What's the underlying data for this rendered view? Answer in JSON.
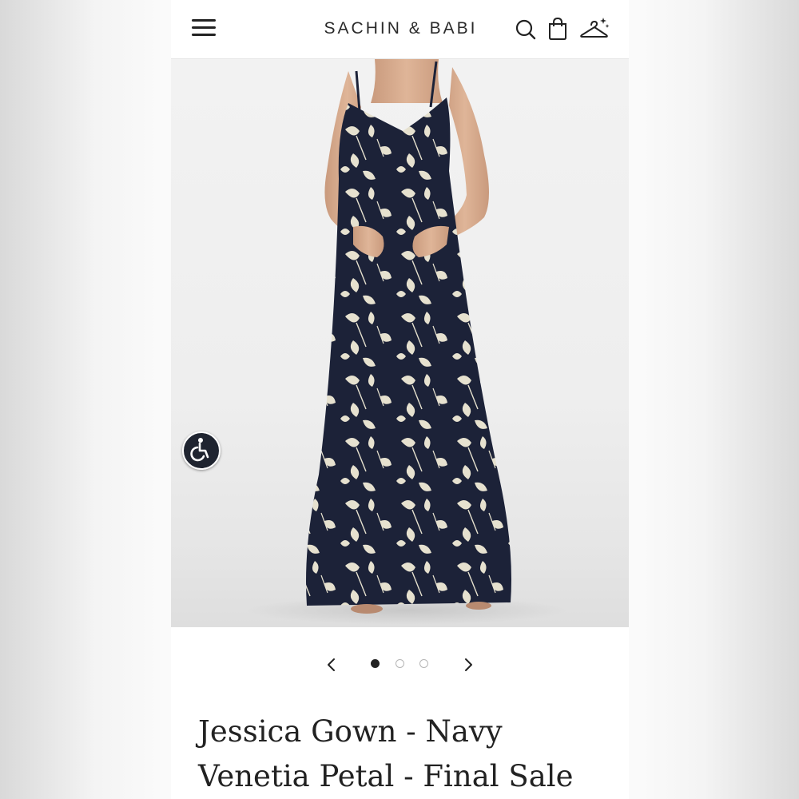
{
  "header": {
    "brand": "SACHIN & BABI",
    "menu_icon": "hamburger-menu-icon",
    "search_icon": "search-icon",
    "bag_icon": "shopping-bag-icon",
    "hanger_icon": "hanger-sparkle-icon"
  },
  "hero": {
    "image_subject": "woman wearing navy floral print maxi gown",
    "accessibility_icon": "wheelchair-accessibility-icon"
  },
  "carousel": {
    "prev_icon": "chevron-left-icon",
    "next_icon": "chevron-right-icon",
    "total_slides": 3,
    "active_slide": 1
  },
  "product": {
    "title_line1": "Jessica Gown - Navy",
    "title_line2": "Venetia Petal - Final Sale"
  },
  "colors": {
    "dress_navy": "#1c2238",
    "petal_cream": "#e6e1cf",
    "text_dark": "#222222",
    "accessibility_bg": "#1f2430"
  }
}
